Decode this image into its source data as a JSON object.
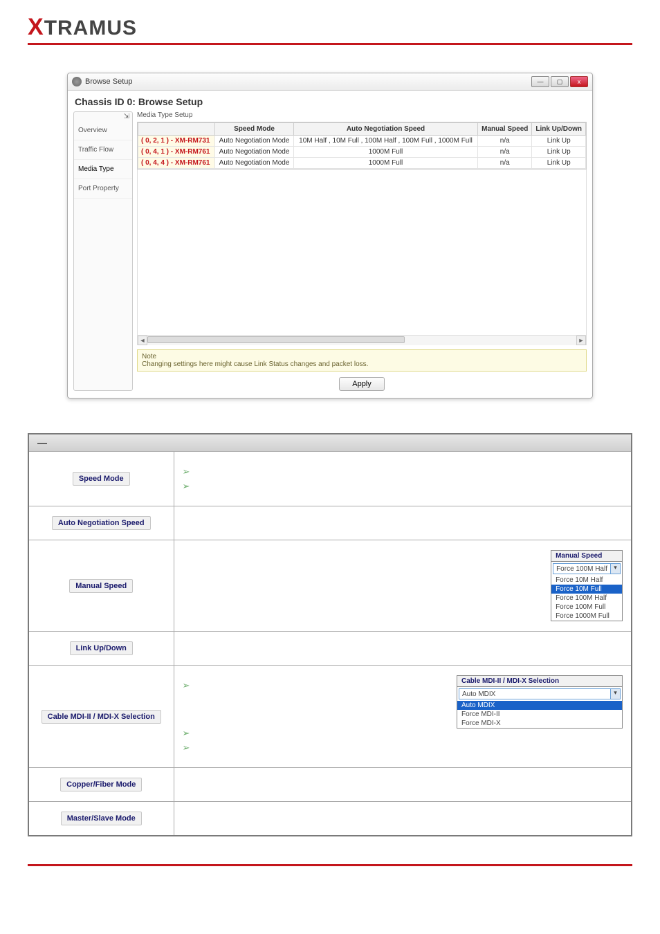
{
  "brand": {
    "x": "X",
    "rest": "TRAMUS"
  },
  "window": {
    "title": "Browse Setup",
    "heading": "Chassis ID 0: Browse Setup",
    "win_min": "—",
    "win_max": "▢",
    "win_close": "x",
    "sidebar": {
      "pin": "⇲",
      "items": [
        "Overview",
        "Traffic Flow",
        "Media Type",
        "Port Property"
      ]
    },
    "content_label": "Media Type Setup",
    "columns": [
      "",
      "Speed Mode",
      "Auto Negotiation Speed",
      "Manual Speed",
      "Link Up/Down"
    ],
    "rows": [
      {
        "port": "( 0, 2, 1 ) - XM-RM731",
        "mode": "Auto Negotiation Mode",
        "auto": "10M Half , 10M Full , 100M Half , 100M Full , 1000M Full",
        "manual": "n/a",
        "link": "Link Up"
      },
      {
        "port": "( 0, 4, 1 ) - XM-RM761",
        "mode": "Auto Negotiation Mode",
        "auto": "1000M Full",
        "manual": "n/a",
        "link": "Link Up"
      },
      {
        "port": "( 0, 4, 4 ) - XM-RM761",
        "mode": "Auto Negotiation Mode",
        "auto": "1000M Full",
        "manual": "n/a",
        "link": "Link Up"
      }
    ],
    "scroll_left": "◄",
    "scroll_right": "►",
    "note_title": "Note",
    "note_body": "Changing settings here might cause Link Status changes and packet loss.",
    "apply": "Apply"
  },
  "table": {
    "dash": "—",
    "rows": {
      "speed_mode": {
        "label": "Speed Mode"
      },
      "auto_neg": {
        "label": "Auto Negotiation Speed"
      },
      "manual_speed": {
        "label": "Manual Speed",
        "panel": {
          "title": "Manual Speed",
          "selected": "Force 100M Half",
          "options": [
            "Force 10M Half",
            "Force 10M Full",
            "Force 100M Half",
            "Force 100M Full",
            "Force 1000M Full"
          ],
          "highlight_index": 1
        }
      },
      "link": {
        "label": "Link Up/Down"
      },
      "cable": {
        "label": "Cable MDI-II / MDI-X Selection",
        "panel": {
          "title": "Cable MDI-II / MDI-X Selection",
          "selected": "Auto MDIX",
          "options": [
            "Auto MDIX",
            "Force MDI-II",
            "Force MDI-X"
          ],
          "highlight_index": 0
        }
      },
      "copper": {
        "label": "Copper/Fiber Mode"
      },
      "master": {
        "label": "Master/Slave Mode"
      }
    }
  }
}
